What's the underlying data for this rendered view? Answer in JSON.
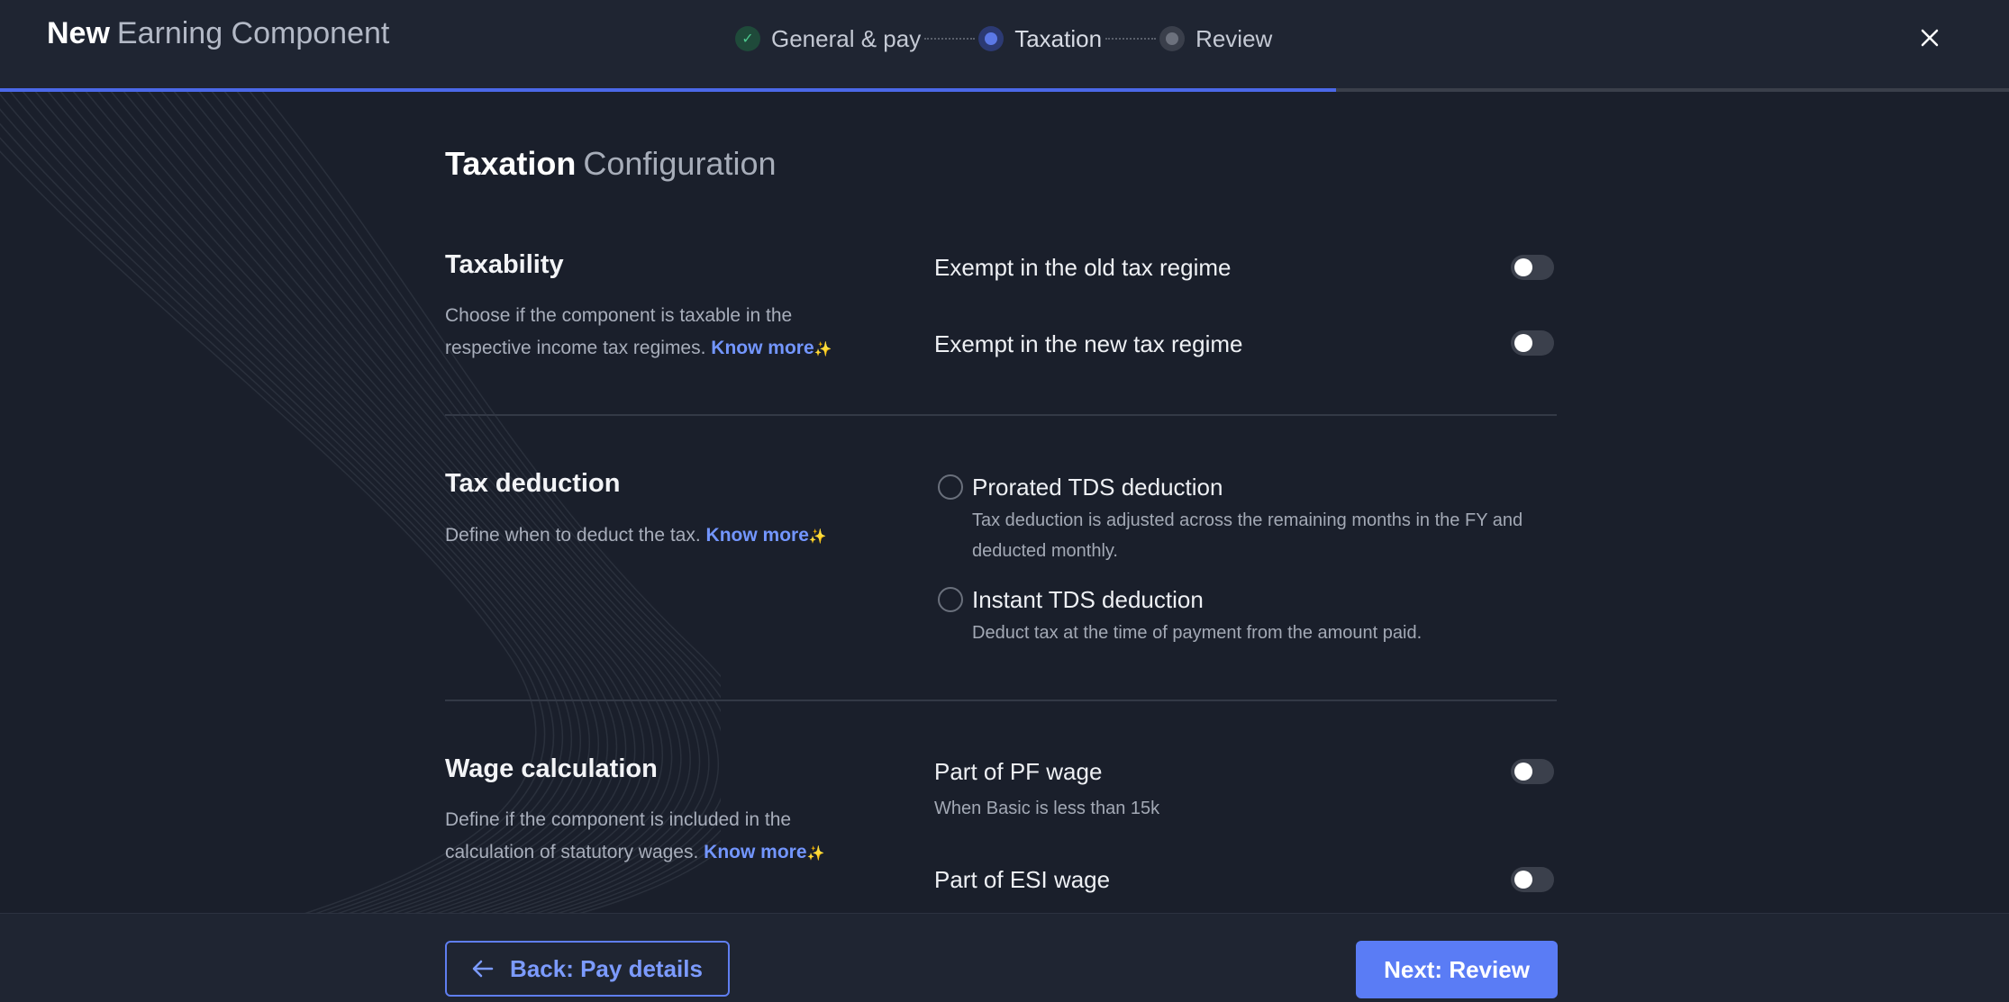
{
  "header": {
    "title_strong": "New",
    "title_light": "Earning Component",
    "close_icon": "close-icon",
    "steps": [
      {
        "label": "General & pay",
        "state": "done"
      },
      {
        "label": "Taxation",
        "state": "active"
      },
      {
        "label": "Review",
        "state": "pending"
      }
    ],
    "progress_percent": 66.5
  },
  "page": {
    "title_strong": "Taxation",
    "title_light": "Configuration"
  },
  "taxability": {
    "title": "Taxability",
    "desc": "Choose if the component is taxable in the respective income tax regimes.",
    "know_more": "Know more",
    "sparkle": "✨",
    "options": [
      {
        "label": "Exempt in the old tax regime",
        "on": false
      },
      {
        "label": "Exempt in the new tax regime",
        "on": false
      }
    ]
  },
  "tax_deduction": {
    "title": "Tax deduction",
    "desc": "Define when to deduct the tax.",
    "know_more": "Know more",
    "sparkle": "✨",
    "options": [
      {
        "label": "Prorated TDS deduction",
        "sub": "Tax deduction is adjusted across the remaining months in the FY and deducted monthly.",
        "selected": false
      },
      {
        "label": "Instant TDS deduction",
        "sub": "Deduct tax at the time of payment from the amount paid.",
        "selected": false
      }
    ]
  },
  "wage_calculation": {
    "title": "Wage calculation",
    "desc": "Define if the component is included in the calculation of statutory wages.",
    "know_more": "Know more",
    "sparkle": "✨",
    "options": [
      {
        "label": "Part of PF wage",
        "sub": "When Basic is less than 15k",
        "on": false
      },
      {
        "label": "Part of ESI wage",
        "on": false
      }
    ]
  },
  "footer": {
    "back_label": "Back: Pay details",
    "back_icon": "arrow-left-icon",
    "next_label": "Next: Review"
  },
  "colors": {
    "accent": "#5a7cf5",
    "link": "#7396ff",
    "background": "#1a1f2b",
    "success": "#4cc78d"
  }
}
